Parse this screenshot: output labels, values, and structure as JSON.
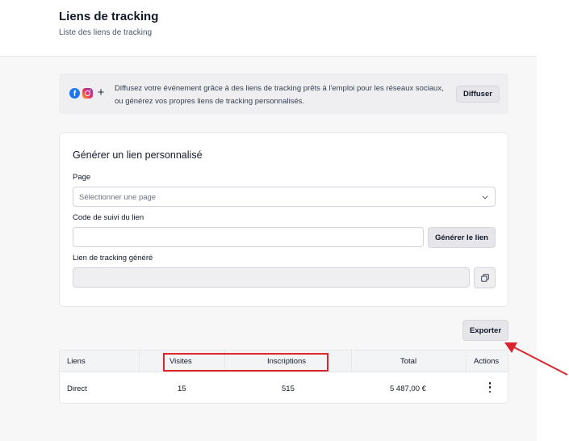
{
  "header": {
    "title": "Liens de tracking",
    "subtitle": "Liste des liens de tracking"
  },
  "banner": {
    "icons": [
      "facebook-icon",
      "instagram-icon",
      "plus-icon"
    ],
    "text": "Diffusez votre événement grâce à des liens de tracking prêts à l'emploi pour les réseaux sociaux, ou générez vos propres liens de tracking personnalisés.",
    "button_label": "Diffuser"
  },
  "generator": {
    "title": "Générer un lien personnalisé",
    "page_label": "Page",
    "page_select_value": "Sélectionner une page",
    "code_label": "Code de suivi du lien",
    "code_value": "",
    "generate_label": "Générer le lien",
    "generated_label": "Lien de tracking généré",
    "generated_value": ""
  },
  "export_label": "Exporter",
  "table": {
    "headers": {
      "liens": "Liens",
      "visites": "Visites",
      "inscriptions": "Inscriptions",
      "total": "Total",
      "actions": "Actions"
    },
    "rows": [
      {
        "liens": "Direct",
        "visites": "15",
        "inscriptions": "515",
        "total": "5 487,00 €"
      }
    ]
  },
  "annotations": {
    "color": "#d9262c"
  }
}
